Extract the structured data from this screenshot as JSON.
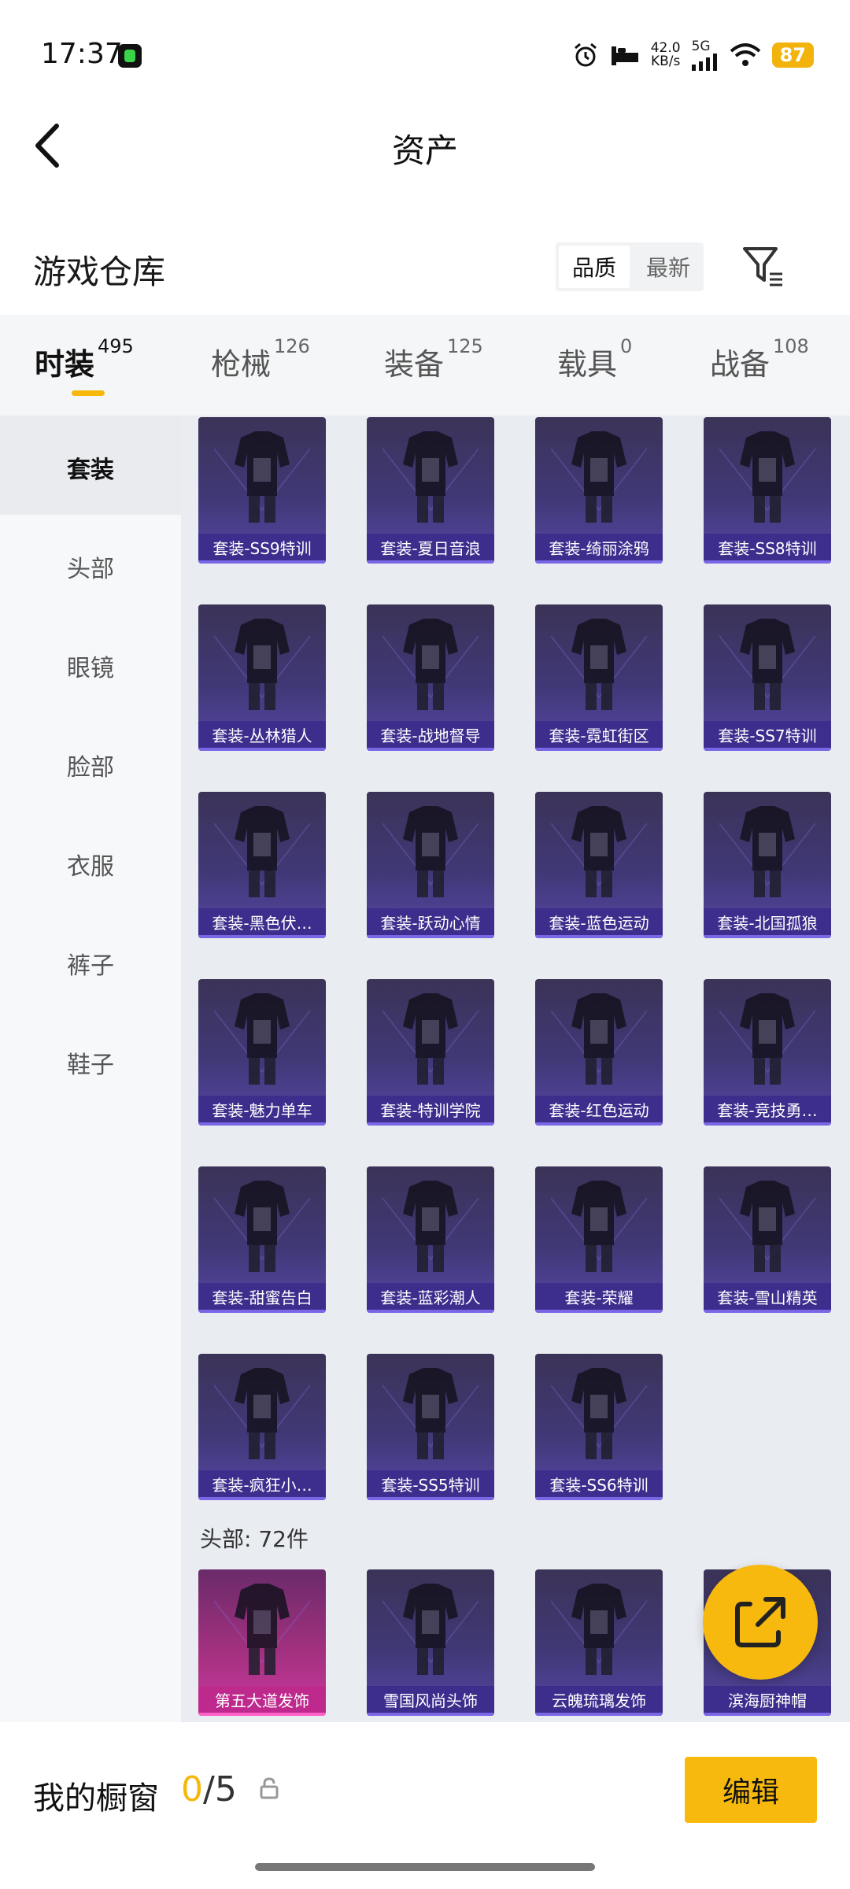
{
  "status_bar": {
    "time": "17:37",
    "net_speed_value": "42.0",
    "net_speed_unit": "KB/s",
    "network_type": "5G",
    "battery": "87"
  },
  "header": {
    "title": "资产"
  },
  "warehouse": {
    "title": "游戏仓库",
    "sort_options": [
      "品质",
      "最新"
    ],
    "active_sort": "品质"
  },
  "tabs": [
    {
      "label": "时装",
      "count": "495"
    },
    {
      "label": "枪械",
      "count": "126"
    },
    {
      "label": "装备",
      "count": "125"
    },
    {
      "label": "载具",
      "count": "0"
    },
    {
      "label": "战备",
      "count": "108"
    }
  ],
  "sidebar": [
    "套装",
    "头部",
    "眼镜",
    "脸部",
    "衣服",
    "裤子",
    "鞋子"
  ],
  "suits": [
    "套装-SS9特训",
    "套装-夏日音浪",
    "套装-绮丽涂鸦",
    "套装-SS8特训",
    "套装-丛林猎人",
    "套装-战地督导",
    "套装-霓虹街区",
    "套装-SS7特训",
    "套装-黑色伏…",
    "套装-跃动心情",
    "套装-蓝色运动",
    "套装-北国孤狼",
    "套装-魅力单车",
    "套装-特训学院",
    "套装-红色运动",
    "套装-竞技勇…",
    "套装-甜蜜告白",
    "套装-蓝彩潮人",
    "套装-荣耀",
    "套装-雪山精英",
    "套装-疯狂小…",
    "套装-SS5特训",
    "套装-SS6特训"
  ],
  "head_section": {
    "label": "头部: 72件",
    "items": [
      "第五大道发饰",
      "雪国风尚头饰",
      "云魄琉璃发饰",
      "滨海厨神帽"
    ]
  },
  "showcase": {
    "title": "我的橱窗",
    "current": "0",
    "separator": "/5",
    "edit_label": "编辑"
  },
  "colors": {
    "accent": "#f7b90e",
    "card_purple": "#403876",
    "card_pink": "#a2307f"
  }
}
